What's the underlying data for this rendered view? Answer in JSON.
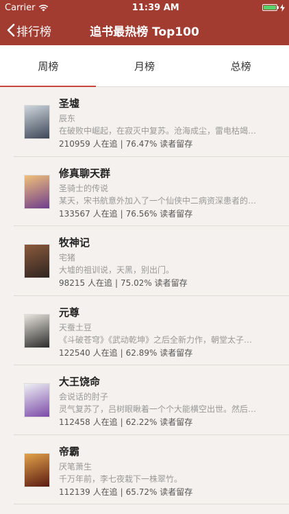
{
  "status_bar": {
    "carrier": "Carrier",
    "time": "11:39 AM"
  },
  "nav": {
    "back_label": "排行榜",
    "title": "追书最热榜 Top100"
  },
  "tabs": [
    {
      "label": "周榜"
    },
    {
      "label": "月榜"
    },
    {
      "label": "总榜"
    }
  ],
  "colors": {
    "brand": "#a23c30",
    "tab_indicator": "#c8453a",
    "background": "#f4f1ee"
  },
  "books": [
    {
      "title": "圣墟",
      "author": "辰东",
      "desc": "在破败中崛起，在寂灭中复苏。沧海成尘，雷电枯竭…",
      "followers": "210959 人在追",
      "retention": "76.47% 读者留存",
      "cover_colors": [
        "#cfd6dd",
        "#3c4656"
      ]
    },
    {
      "title": "修真聊天群",
      "author": "圣骑士的传说",
      "desc": "某天，宋书航意外加入了一个仙侠中二病资深患者的…",
      "followers": "133567 人在追",
      "retention": "76.56% 读者留存",
      "cover_colors": [
        "#f0c07a",
        "#6e3d8c"
      ]
    },
    {
      "title": "牧神记",
      "author": "宅猪",
      "desc": "大墟的祖训说，天黑，别出门。",
      "followers": "98215 人在追",
      "retention": "75.02% 读者留存",
      "cover_colors": [
        "#8b5a3c",
        "#2e2420"
      ]
    },
    {
      "title": "元尊",
      "author": "天蚕土豆",
      "desc": "《斗破苍穹》《武动乾坤》之后全新力作，朝堂太子…",
      "followers": "122540 人在追",
      "retention": "62.89% 读者留存",
      "cover_colors": [
        "#e8e4dd",
        "#2b2b2b"
      ]
    },
    {
      "title": "大王饶命",
      "author": "会说话的肘子",
      "desc": "灵气复苏了，吕树眼瞅着一个个大能横空出世。然后…",
      "followers": "112458 人在追",
      "retention": "62.22% 读者留存",
      "cover_colors": [
        "#eef0f4",
        "#7b4aa8"
      ]
    },
    {
      "title": "帝霸",
      "author": "厌笔萧生",
      "desc": "千万年前，李七夜栽下一株翠竹。",
      "followers": "112139 人在追",
      "retention": "65.72% 读者留存",
      "cover_colors": [
        "#e2a34a",
        "#5a1a12"
      ]
    }
  ]
}
